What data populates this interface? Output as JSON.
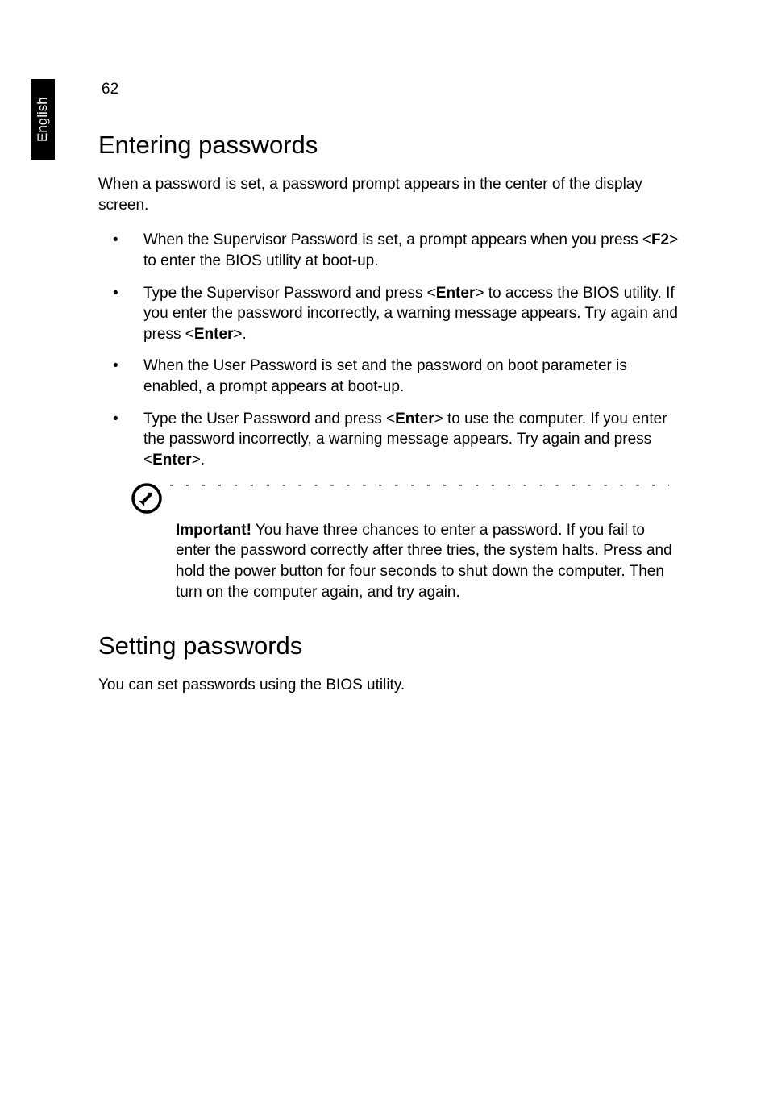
{
  "sidebar": {
    "language": "English"
  },
  "page": {
    "number": "62"
  },
  "sections": [
    {
      "heading": "Entering passwords",
      "intro": "When a password is set, a password prompt appears in the center of the display screen.",
      "bullets": [
        {
          "runs": [
            {
              "t": "When the Supervisor Password is set, a prompt appears when you press <"
            },
            {
              "t": "F2",
              "bold": true
            },
            {
              "t": "> to enter the BIOS utility at boot-up."
            }
          ]
        },
        {
          "runs": [
            {
              "t": "Type the Supervisor Password and press <"
            },
            {
              "t": "Enter",
              "bold": true
            },
            {
              "t": "> to access the BIOS utility. If you enter the password incorrectly, a warning message appears. Try again and press <"
            },
            {
              "t": "Enter",
              "bold": true
            },
            {
              "t": ">."
            }
          ]
        },
        {
          "runs": [
            {
              "t": "When the User Password is set and the password on boot parameter is enabled, a prompt appears at boot-up."
            }
          ]
        },
        {
          "runs": [
            {
              "t": "Type the User Password and press <"
            },
            {
              "t": "Enter",
              "bold": true
            },
            {
              "t": "> to use the computer. If you enter the password incorrectly, a warning message appears. Try again and press <"
            },
            {
              "t": "Enter",
              "bold": true
            },
            {
              "t": ">."
            }
          ]
        }
      ],
      "callout": {
        "label": "Important!",
        "text": " You have three chances to enter a password. If you fail to enter the password correctly after three tries, the system halts. Press and hold the power button for four seconds to shut down the computer. Then turn on the computer again, and try again."
      }
    },
    {
      "heading": "Setting passwords",
      "intro": "You can set passwords using the BIOS utility."
    }
  ],
  "dashes": "- - - - - - - - - - - - - - - - - - - - - - - - - - - - - - - - - - - - - - - - - - - - - - - - -"
}
